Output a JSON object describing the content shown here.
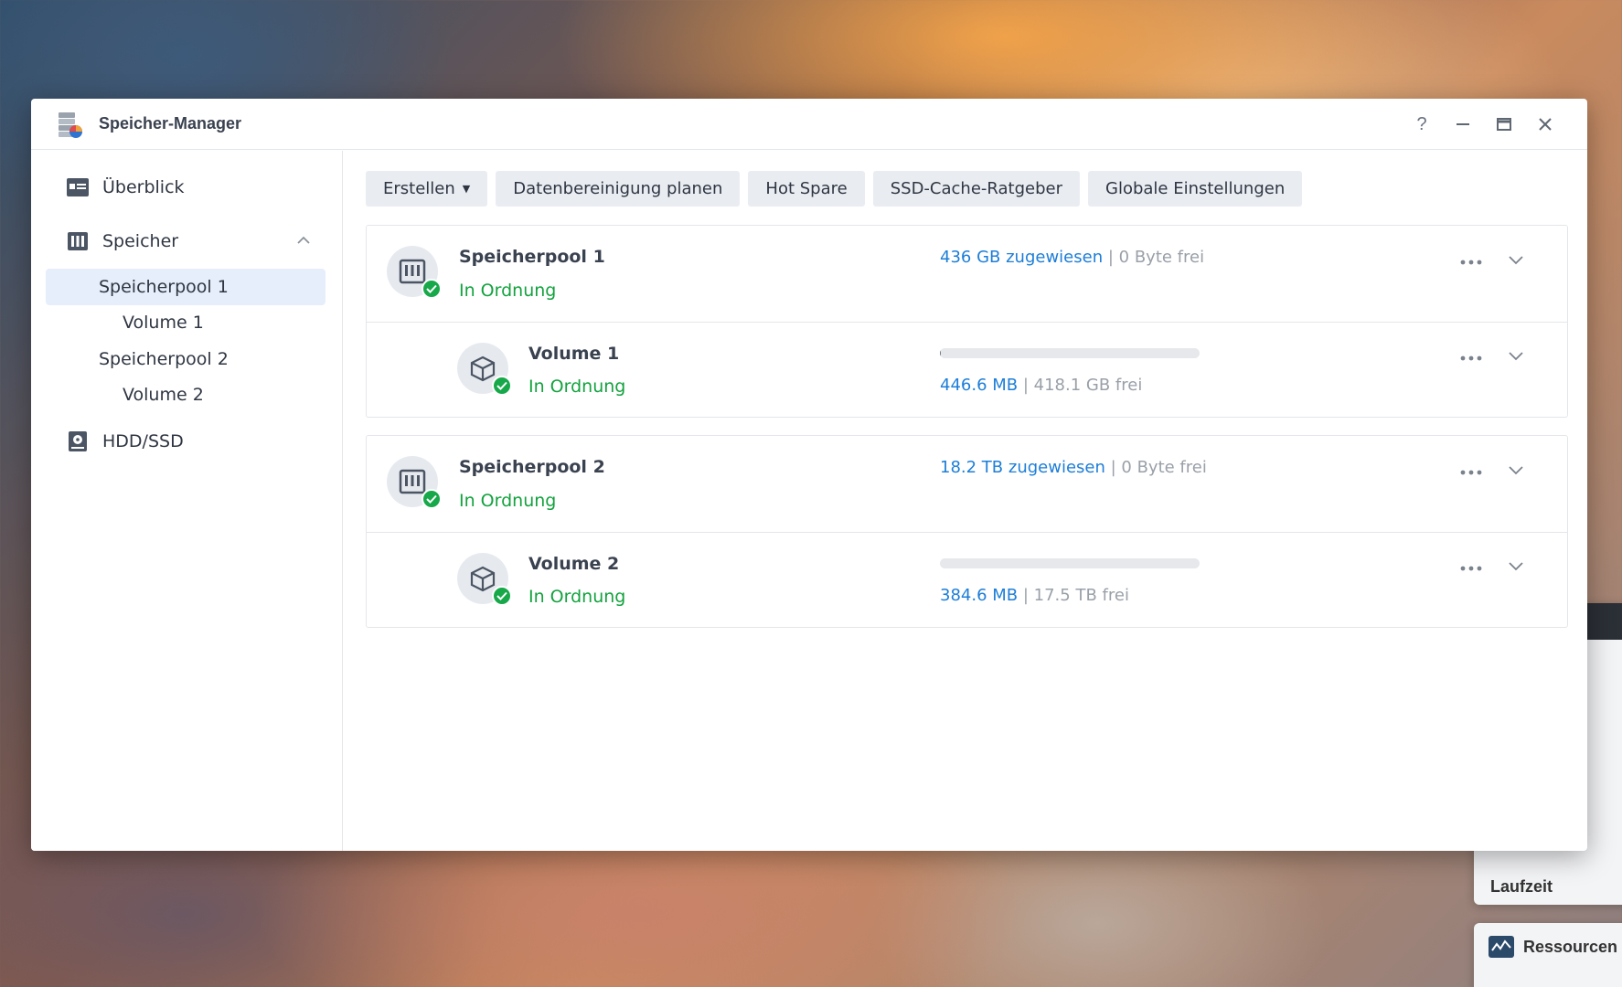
{
  "window": {
    "title": "Speicher-Manager",
    "help": "?"
  },
  "sidebar": {
    "overview": "Überblick",
    "storage": "Speicher",
    "pool1": "Speicherpool 1",
    "volume1": "Volume 1",
    "pool2": "Speicherpool 2",
    "volume2": "Volume 2",
    "hdd": "HDD/SSD"
  },
  "toolbar": {
    "create": "Erstellen",
    "scrub": "Datenbereinigung planen",
    "hotspare": "Hot Spare",
    "ssd": "SSD-Cache-Ratgeber",
    "global": "Globale Einstellungen"
  },
  "pools": [
    {
      "name": "Speicherpool 1",
      "status": "In Ordnung",
      "allocated": "436 GB zugewiesen",
      "sep": " | ",
      "free": "0 Byte frei",
      "volume": {
        "name": "Volume 1",
        "status": "In Ordnung",
        "used": "446.6 MB",
        "sep": " | ",
        "free": "418.1 GB frei",
        "usage_fraction": 0.001
      }
    },
    {
      "name": "Speicherpool 2",
      "status": "In Ordnung",
      "allocated": "18.2 TB zugewiesen",
      "sep": " | ",
      "free": "0 Byte frei",
      "volume": {
        "name": "Volume 2",
        "status": "In Ordnung",
        "used": "384.6 MB",
        "sep": " | ",
        "free": "17.5 TB frei",
        "usage_fraction": 0.0
      }
    }
  ],
  "background": {
    "widget_label": "Laufzeit",
    "widget2_title": "Ressourcen"
  },
  "colors": {
    "ok_green": "#13a23e",
    "link_blue": "#1d7ed8",
    "active_nav": "#e6eefb"
  }
}
